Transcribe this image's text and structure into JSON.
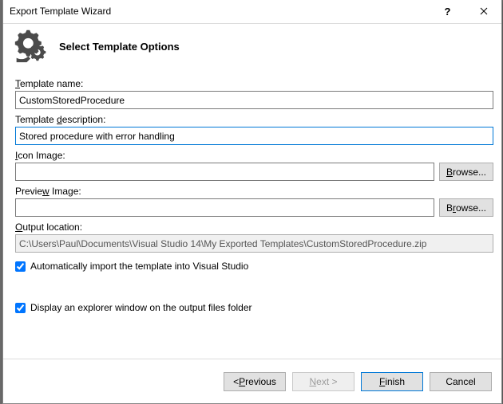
{
  "title": "Export Template Wizard",
  "heading": "Select Template Options",
  "labels": {
    "template_name": "Template name:",
    "template_description": "Template description:",
    "icon_image": "Icon Image:",
    "preview_image": "Preview Image:",
    "output_location": "Output location:"
  },
  "fields": {
    "template_name": "CustomStoredProcedure",
    "template_description": "Stored procedure with error handling",
    "icon_image": "",
    "preview_image": "",
    "output_location": "C:\\Users\\Paul\\Documents\\Visual Studio 14\\My Exported Templates\\CustomStoredProcedure.zip"
  },
  "buttons": {
    "browse": "Browse...",
    "previous": "< Previous",
    "next": "Next >",
    "finish": "Finish",
    "cancel": "Cancel"
  },
  "checkboxes": {
    "auto_import": "Automatically import the template into Visual Studio",
    "open_explorer": "Display an explorer window on the output files folder"
  }
}
